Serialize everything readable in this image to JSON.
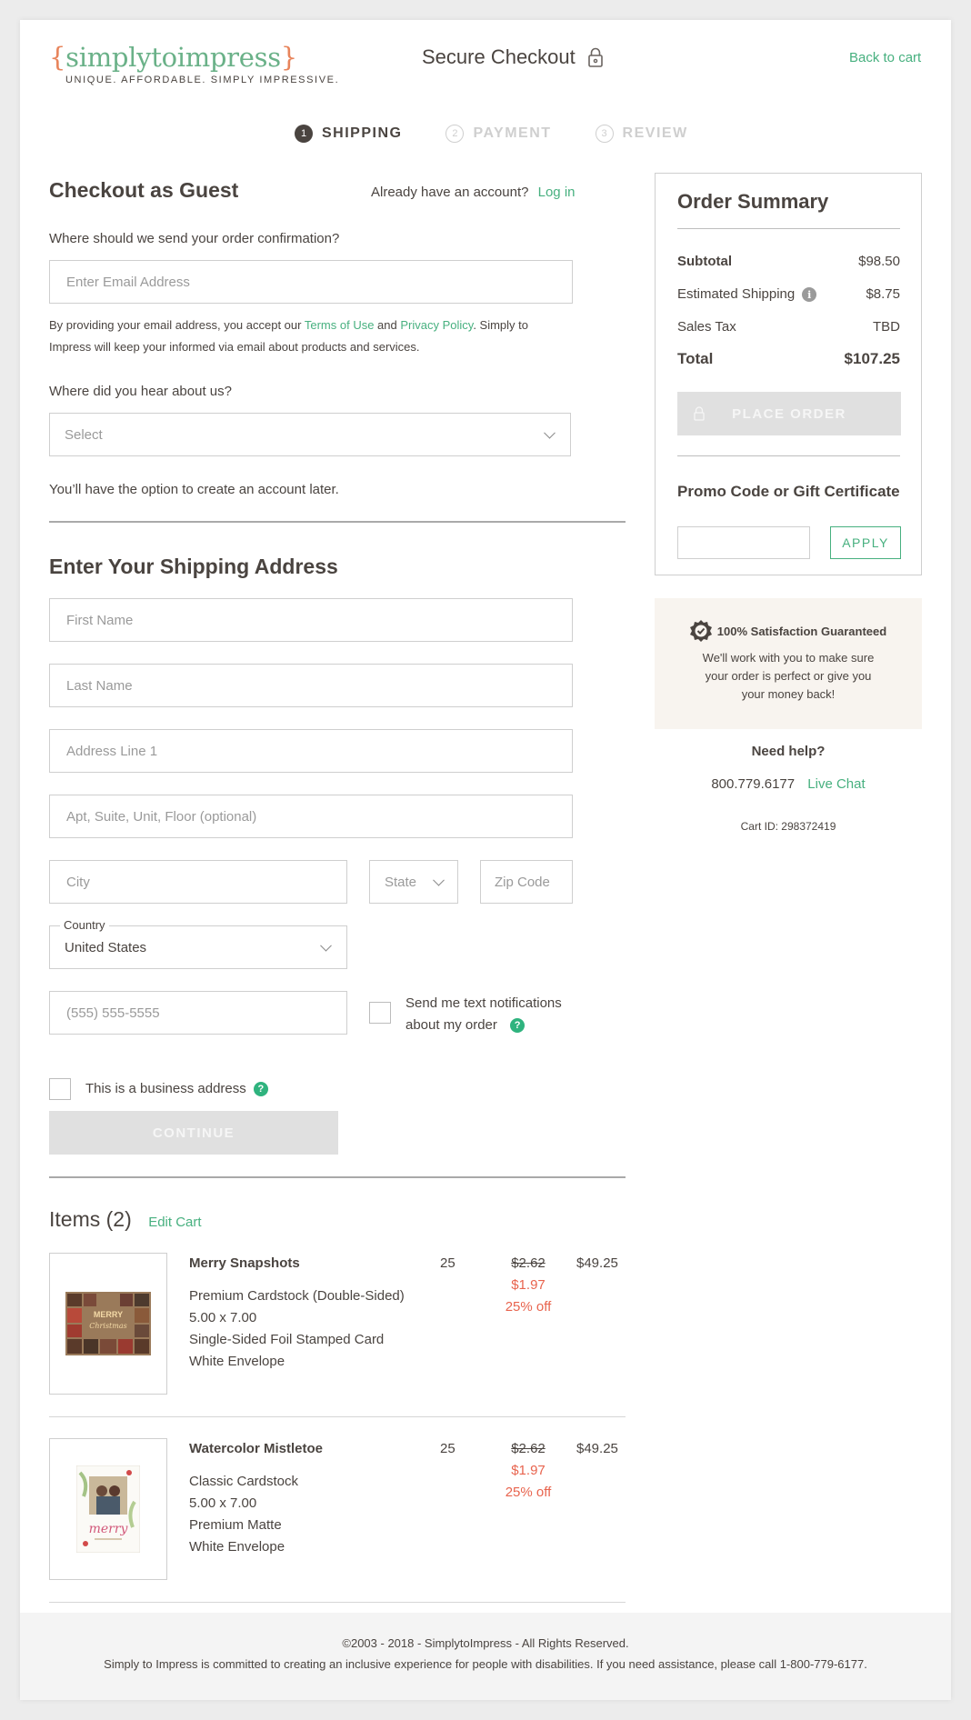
{
  "header": {
    "logo_name": "simplytoimpress",
    "logo_tagline": "UNIQUE. AFFORDABLE. SIMPLY IMPRESSIVE.",
    "title": "Secure Checkout",
    "back_link": "Back to cart"
  },
  "steps": [
    {
      "num": "1",
      "label": "SHIPPING",
      "active": true
    },
    {
      "num": "2",
      "label": "PAYMENT",
      "active": false
    },
    {
      "num": "3",
      "label": "REVIEW",
      "active": false
    }
  ],
  "guest": {
    "title": "Checkout as Guest",
    "have_account": "Already have an account?",
    "login_link": "Log in",
    "email_question": "Where should we send your order confirmation?",
    "email_placeholder": "Enter Email Address",
    "disclaimer_pre": "By providing your email address, you  accept our ",
    "terms_link": "Terms of Use",
    "disclaimer_and": " and ",
    "privacy_link": "Privacy Policy",
    "disclaimer_post": ". Simply to Impress will keep your informed via email about products and services.",
    "hear_question": "Where did you hear about us?",
    "hear_select_value": "Select",
    "account_later": "You’ll have the option to create an account later."
  },
  "shipping": {
    "title": "Enter Your Shipping Address",
    "first_name_placeholder": "First Name",
    "last_name_placeholder": "Last Name",
    "address1_placeholder": "Address Line 1",
    "address2_placeholder": "Apt, Suite, Unit, Floor (optional)",
    "city_placeholder": "City",
    "state_value": "State",
    "zip_placeholder": "Zip Code",
    "country_label": "Country",
    "country_value": "United States",
    "phone_placeholder": "(555) 555-5555",
    "text_notify_line1": "Send me text notifications",
    "text_notify_line2": "about my order",
    "business_address": "This is a business address",
    "continue_label": "CONTINUE"
  },
  "items": {
    "title": "Items (2)",
    "edit_cart": "Edit Cart",
    "list": [
      {
        "name": "Merry Snapshots",
        "details": [
          "Premium Cardstock (Double-Sided)",
          "5.00 x 7.00",
          "Single-Sided Foil Stamped Card",
          "White Envelope"
        ],
        "qty": "25",
        "old_price": "$2.62",
        "new_price": "$1.97",
        "discount": "25% off",
        "total": "$49.25"
      },
      {
        "name": "Watercolor Mistletoe",
        "details": [
          "Classic Cardstock",
          "5.00 x 7.00",
          "Premium Matte",
          "White Envelope"
        ],
        "qty": "25",
        "old_price": "$2.62",
        "new_price": "$1.97",
        "discount": "25% off",
        "total": "$49.25"
      }
    ],
    "card1_text": [
      "MERRY",
      "Christmas"
    ],
    "card2_text": "merry"
  },
  "summary": {
    "title": "Order Summary",
    "subtotal_label": "Subtotal",
    "subtotal_value": "$98.50",
    "shipping_label": "Estimated Shipping",
    "shipping_value": "$8.75",
    "tax_label": "Sales Tax",
    "tax_value": "TBD",
    "total_label": "Total",
    "total_value": "$107.25",
    "place_order": "PLACE ORDER",
    "promo_title": "Promo Code or Gift Certificate",
    "apply": "APPLY"
  },
  "guarantee": {
    "title": "100% Satisfaction Guaranteed",
    "line1": "We'll work with you to make sure",
    "line2": "your order is perfect or give you",
    "line3": "your money back!"
  },
  "help": {
    "title": "Need help?",
    "phone": "800.779.6177",
    "chat": "Live Chat",
    "cart_id": "Cart ID: 298372419"
  },
  "footer": {
    "copyright": "©2003 - 2018 - SimplytoImpress - All Rights Reserved.",
    "accessibility": "Simply to Impress is committed to creating an inclusive experience for people with disabilities. If you need assistance, please call 1-800-779-6177."
  },
  "colors": {
    "brand_green": "#47b07f",
    "brand_orange": "#e8845b",
    "text": "#4a4440",
    "sale_red": "#e8644e",
    "disabled_button": "#e0e0e0",
    "guarantee_bg": "#f8f4ef"
  },
  "icons": [
    "lock-icon",
    "info-icon",
    "help-icon",
    "checkmark-badge-icon",
    "chevron-down-icon"
  ]
}
